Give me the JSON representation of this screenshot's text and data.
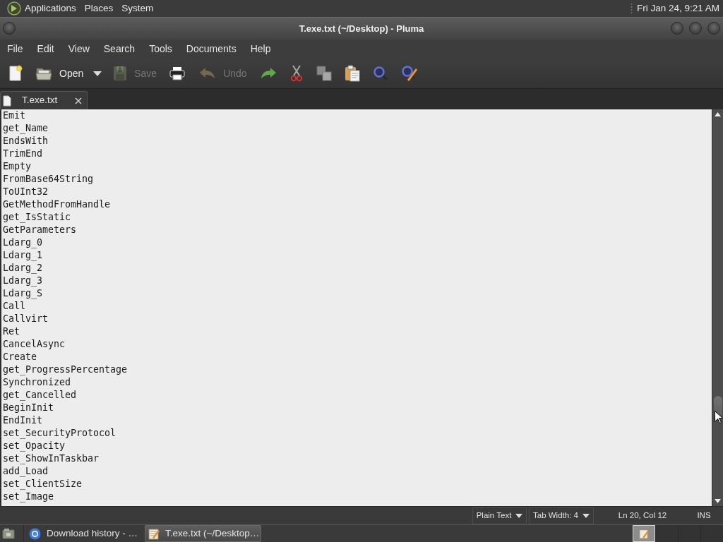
{
  "top_panel": {
    "menus": [
      "Applications",
      "Places",
      "System"
    ],
    "clock": "Fri Jan 24, 9:21 AM"
  },
  "window": {
    "title": "T.exe.txt (~/Desktop) - Pluma"
  },
  "menu_bar": [
    "File",
    "Edit",
    "View",
    "Search",
    "Tools",
    "Documents",
    "Help"
  ],
  "toolbar": [
    {
      "kind": "new",
      "disabled": false
    },
    {
      "kind": "open",
      "label": "Open",
      "disabled": false
    },
    {
      "kind": "recent",
      "disabled": false
    },
    {
      "kind": "save",
      "label": "Save",
      "disabled": true
    },
    {
      "kind": "print",
      "disabled": false
    },
    {
      "kind": "undo",
      "label": "Undo",
      "disabled": true
    },
    {
      "kind": "redo",
      "disabled": false
    },
    {
      "kind": "cut",
      "disabled": false
    },
    {
      "kind": "copy",
      "disabled": false
    },
    {
      "kind": "paste",
      "disabled": false
    },
    {
      "kind": "find",
      "disabled": false
    },
    {
      "kind": "replace",
      "disabled": false
    }
  ],
  "tabs": [
    {
      "label": "T.exe.txt",
      "selected": true
    }
  ],
  "editor": {
    "lines": [
      "Emit",
      "get_Name",
      "EndsWith",
      "TrimEnd",
      "Empty",
      "FromBase64String",
      "ToUInt32",
      "GetMethodFromHandle",
      "get_IsStatic",
      "GetParameters",
      "Ldarg_0",
      "Ldarg_1",
      "Ldarg_2",
      "Ldarg_3",
      "Ldarg_S",
      "Call",
      "Callvirt",
      "Ret",
      "CancelAsync",
      "Create",
      "get_ProgressPercentage",
      "Synchronized",
      "get_Cancelled",
      "BeginInit",
      "EndInit",
      "set_SecurityProtocol",
      "set_Opacity",
      "set_ShowInTaskbar",
      "add_Load",
      "set_ClientSize",
      "set_Image"
    ]
  },
  "status_bar": {
    "language": "Plain Text",
    "tab_width": "Tab Width: 4",
    "position": "Ln 20, Col 12",
    "mode": "INS"
  },
  "taskbar": {
    "windows": [
      {
        "kind": "browser",
        "label": "Download history - …",
        "selected": false
      },
      {
        "kind": "editor",
        "label": "T.exe.txt (~/Desktop…",
        "selected": true
      }
    ],
    "workspaces": [
      {
        "selected": true
      },
      {
        "selected": false
      },
      {
        "selected": false
      },
      {
        "selected": false
      }
    ]
  }
}
